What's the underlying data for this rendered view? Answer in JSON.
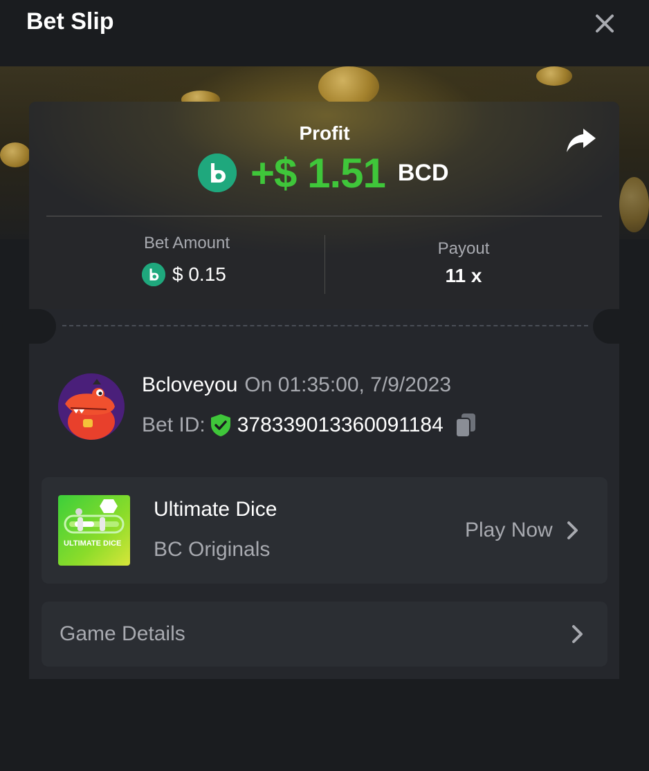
{
  "header": {
    "title": "Bet Slip",
    "close_icon": "close-icon"
  },
  "profit": {
    "label": "Profit",
    "value": "+$ 1.51",
    "currency": "BCD",
    "coin_icon": "bcd-coin-icon",
    "share_icon": "share-icon"
  },
  "stats": {
    "bet_amount_label": "Bet Amount",
    "bet_amount_value": "$ 0.15",
    "payout_label": "Payout",
    "payout_value": "11 x"
  },
  "user": {
    "username": "Bcloveyou",
    "datetime": "On 01:35:00, 7/9/2023",
    "bet_id_label": "Bet ID:",
    "bet_id": "378339013360091184",
    "verified_icon": "shield-check-icon",
    "copy_icon": "copy-icon"
  },
  "game": {
    "name": "Ultimate Dice",
    "provider": "BC Originals",
    "play_label": "Play Now",
    "thumbnail_text": "ULTIMATE DICE"
  },
  "details": {
    "label": "Game Details"
  },
  "colors": {
    "profit_green": "#3fc63a",
    "coin_teal": "#1fa87d",
    "background": "#1a1c1f",
    "card": "#25272c",
    "muted_text": "#a8aab0"
  }
}
